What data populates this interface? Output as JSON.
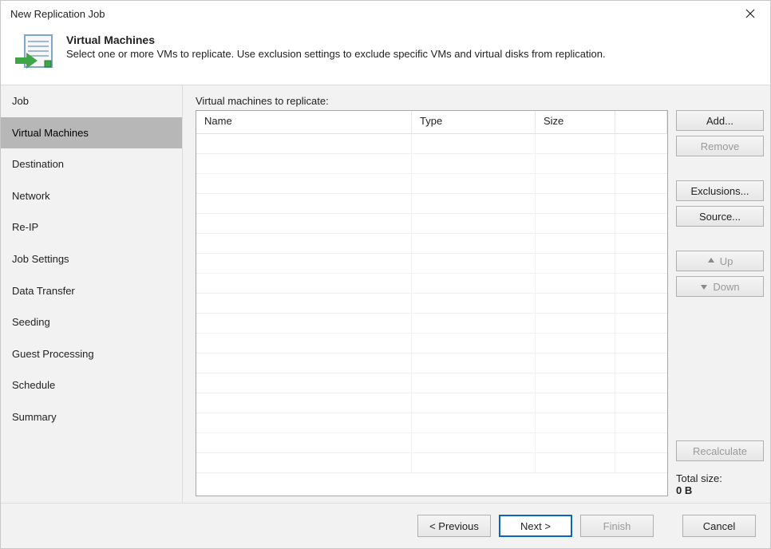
{
  "window": {
    "title": "New Replication Job"
  },
  "header": {
    "title": "Virtual Machines",
    "description": "Select one or more VMs to replicate. Use exclusion settings to exclude specific VMs and virtual disks from replication."
  },
  "sidebar": {
    "items": [
      {
        "label": "Job"
      },
      {
        "label": "Virtual Machines"
      },
      {
        "label": "Destination"
      },
      {
        "label": "Network"
      },
      {
        "label": "Re-IP"
      },
      {
        "label": "Job Settings"
      },
      {
        "label": "Data Transfer"
      },
      {
        "label": "Seeding"
      },
      {
        "label": "Guest Processing"
      },
      {
        "label": "Schedule"
      },
      {
        "label": "Summary"
      }
    ],
    "selected_index": 1
  },
  "main": {
    "list_label": "Virtual machines to replicate:",
    "columns": {
      "name": "Name",
      "type": "Type",
      "size": "Size"
    },
    "rows": []
  },
  "buttons": {
    "add": "Add...",
    "remove": "Remove",
    "exclusions": "Exclusions...",
    "source": "Source...",
    "up": "Up",
    "down": "Down",
    "recalculate": "Recalculate"
  },
  "totals": {
    "label": "Total size:",
    "value": "0 B"
  },
  "footer": {
    "previous": "< Previous",
    "next": "Next >",
    "finish": "Finish",
    "cancel": "Cancel"
  }
}
